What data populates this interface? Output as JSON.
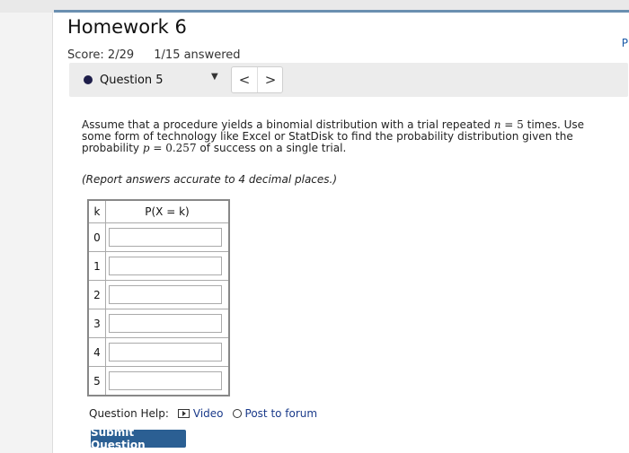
{
  "header": {
    "title": "Homework 6",
    "score": "Score: 2/29",
    "answered": "1/15 answered",
    "edge_letter": "P"
  },
  "question_nav": {
    "selected": "Question 5",
    "prev_icon": "chevron-left-icon",
    "next_icon": "chevron-right-icon",
    "prev_glyph": "<",
    "next_glyph": ">"
  },
  "question": {
    "text_part1": "Assume that a procedure yields a binomial distribution with a trial repeated ",
    "n_var": "n",
    "n_eq": " = ",
    "n_val": "5",
    "text_part2": " times. Use some form of technology like Excel or StatDisk to find the probability distribution given the probability ",
    "p_var": "p",
    "p_eq": " = ",
    "p_val": "0.257",
    "text_part3": " of success on a single trial.",
    "instruction": "(Report answers accurate to 4 decimal places.)"
  },
  "table": {
    "header_k": "k",
    "header_p": "P(X = k)",
    "rows": [
      {
        "k": "0",
        "value": ""
      },
      {
        "k": "1",
        "value": ""
      },
      {
        "k": "2",
        "value": ""
      },
      {
        "k": "3",
        "value": ""
      },
      {
        "k": "4",
        "value": ""
      },
      {
        "k": "5",
        "value": ""
      }
    ]
  },
  "help": {
    "label": "Question Help:",
    "video": "Video",
    "forum": "Post to forum"
  },
  "submit_label": "Submit Question"
}
